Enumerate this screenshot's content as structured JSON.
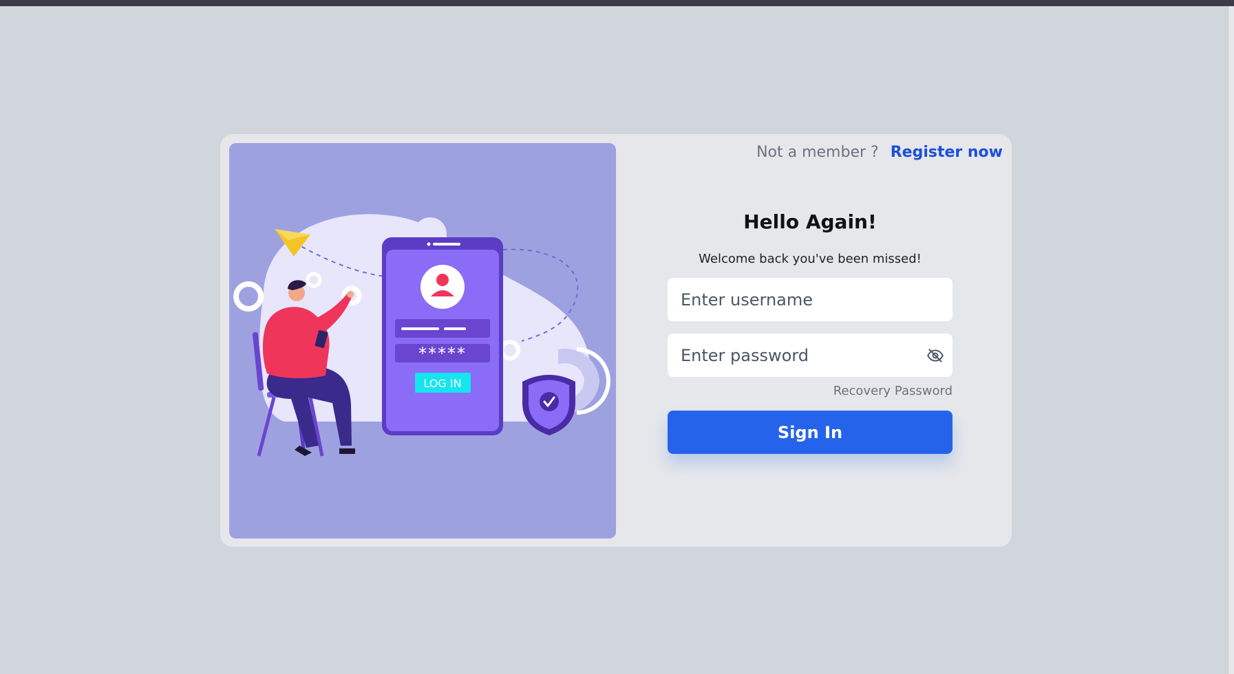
{
  "header": {
    "member_text": "Not a member ?",
    "register_label": "Register now"
  },
  "form": {
    "title": "Hello Again!",
    "subtitle": "Welcome back you've been missed!",
    "username_placeholder": "Enter username",
    "password_placeholder": "Enter password",
    "recovery_label": "Recovery Password",
    "signin_label": "Sign In"
  },
  "illustration": {
    "phone_password_mask": "*****",
    "phone_login_label": "LOG IN"
  },
  "colors": {
    "background": "#d1d5dc",
    "card": "#e5e7eb",
    "illustration_bg": "#9ea1e0",
    "primary": "#2563eb",
    "link": "#1d4ed8"
  },
  "icons": {
    "password_toggle": "eye-off-icon"
  }
}
